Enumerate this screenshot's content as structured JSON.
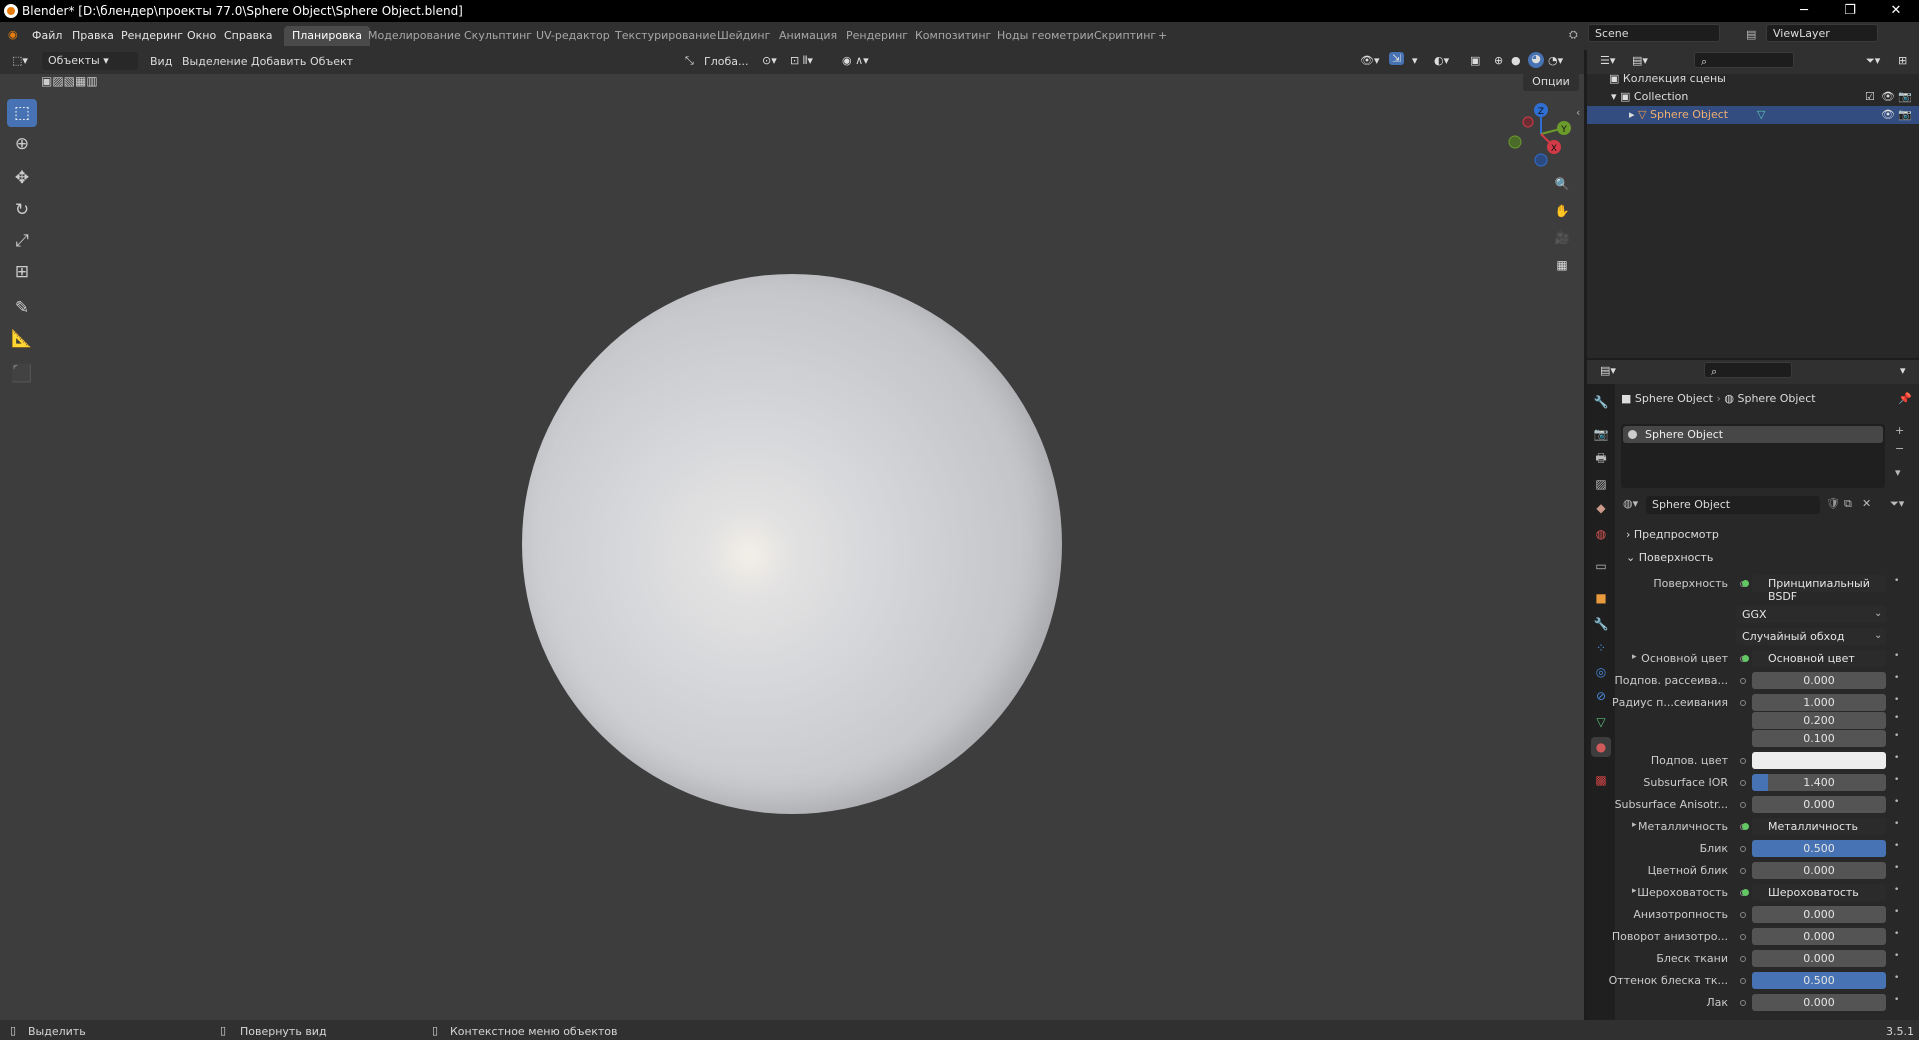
{
  "window": {
    "title": "Blender* [D:\\блендер\\проекты 77.0\\Sphere Object\\Sphere Object.blend]",
    "minimize": "─",
    "maximize": "❐",
    "close": "✕"
  },
  "menu": [
    "Файл",
    "Правка",
    "Рендеринг",
    "Окно",
    "Справка"
  ],
  "workspaces": [
    "Планировка",
    "Моделирование",
    "Скульптинг",
    "UV-редактор",
    "Текстурирование",
    "Шейдинг",
    "Анимация",
    "Рендеринг",
    "Композитинг",
    "Ноды геометрии",
    "Скриптинг"
  ],
  "workspace_add": "+",
  "scene": "Scene",
  "view_layer": "ViewLayer",
  "viewport_header": {
    "mode": "Объекты",
    "items": [
      "Вид",
      "Выделение",
      "Добавить",
      "Объект"
    ],
    "orientation": "Глоба...",
    "options": "Опции"
  },
  "gizmo": {
    "z": "Z",
    "y": "Y",
    "x": "X"
  },
  "outliner": {
    "scene_collection": "Коллекция сцены",
    "collection": "Collection",
    "object": "Sphere Object"
  },
  "properties": {
    "breadcrumb": [
      "Sphere Object",
      "Sphere Object"
    ],
    "slot": "Sphere Object",
    "material": "Sphere Object",
    "panels": {
      "preview": "Предпросмотр",
      "surface": "Поверхность"
    },
    "rows": [
      {
        "label": "Поверхность",
        "value": "Принципиальный BSDF",
        "kind": "dark"
      },
      {
        "label": "",
        "value": "GGX",
        "kind": "dark"
      },
      {
        "label": "",
        "value": "Случайный обход",
        "kind": "dark"
      },
      {
        "label": "Основной цвет",
        "value": "Основной цвет",
        "kind": "dark"
      },
      {
        "label": "Подпов. рассеива...",
        "value": "0.000",
        "kind": "num"
      },
      {
        "label": "Радиус п...сеивания",
        "value": "1.000",
        "kind": "num"
      },
      {
        "label": "",
        "value": "0.200",
        "kind": "num"
      },
      {
        "label": "",
        "value": "0.100",
        "kind": "num"
      },
      {
        "label": "Подпов. цвет",
        "value": "",
        "kind": "color"
      },
      {
        "label": "Subsurface IOR",
        "value": "1.400",
        "kind": "num"
      },
      {
        "label": "Subsurface Anisotr...",
        "value": "0.000",
        "kind": "num"
      },
      {
        "label": "Металличность",
        "value": "Металличность",
        "kind": "dark"
      },
      {
        "label": "Блик",
        "value": "0.500",
        "kind": "blue"
      },
      {
        "label": "Цветной блик",
        "value": "0.000",
        "kind": "num"
      },
      {
        "label": "Шероховатость",
        "value": "Шероховатость",
        "kind": "dark"
      },
      {
        "label": "Анизотропность",
        "value": "0.000",
        "kind": "num"
      },
      {
        "label": "Поворот анизотро...",
        "value": "0.000",
        "kind": "num"
      },
      {
        "label": "Блеск ткани",
        "value": "0.000",
        "kind": "num"
      },
      {
        "label": "Оттенок блеска тк...",
        "value": "0.500",
        "kind": "blue"
      },
      {
        "label": "Лак",
        "value": "0.000",
        "kind": "num"
      }
    ]
  },
  "status": {
    "select": "Выделить",
    "rotate": "Повернуть вид",
    "context": "Контекстное меню объектов",
    "version": "3.5.1"
  }
}
